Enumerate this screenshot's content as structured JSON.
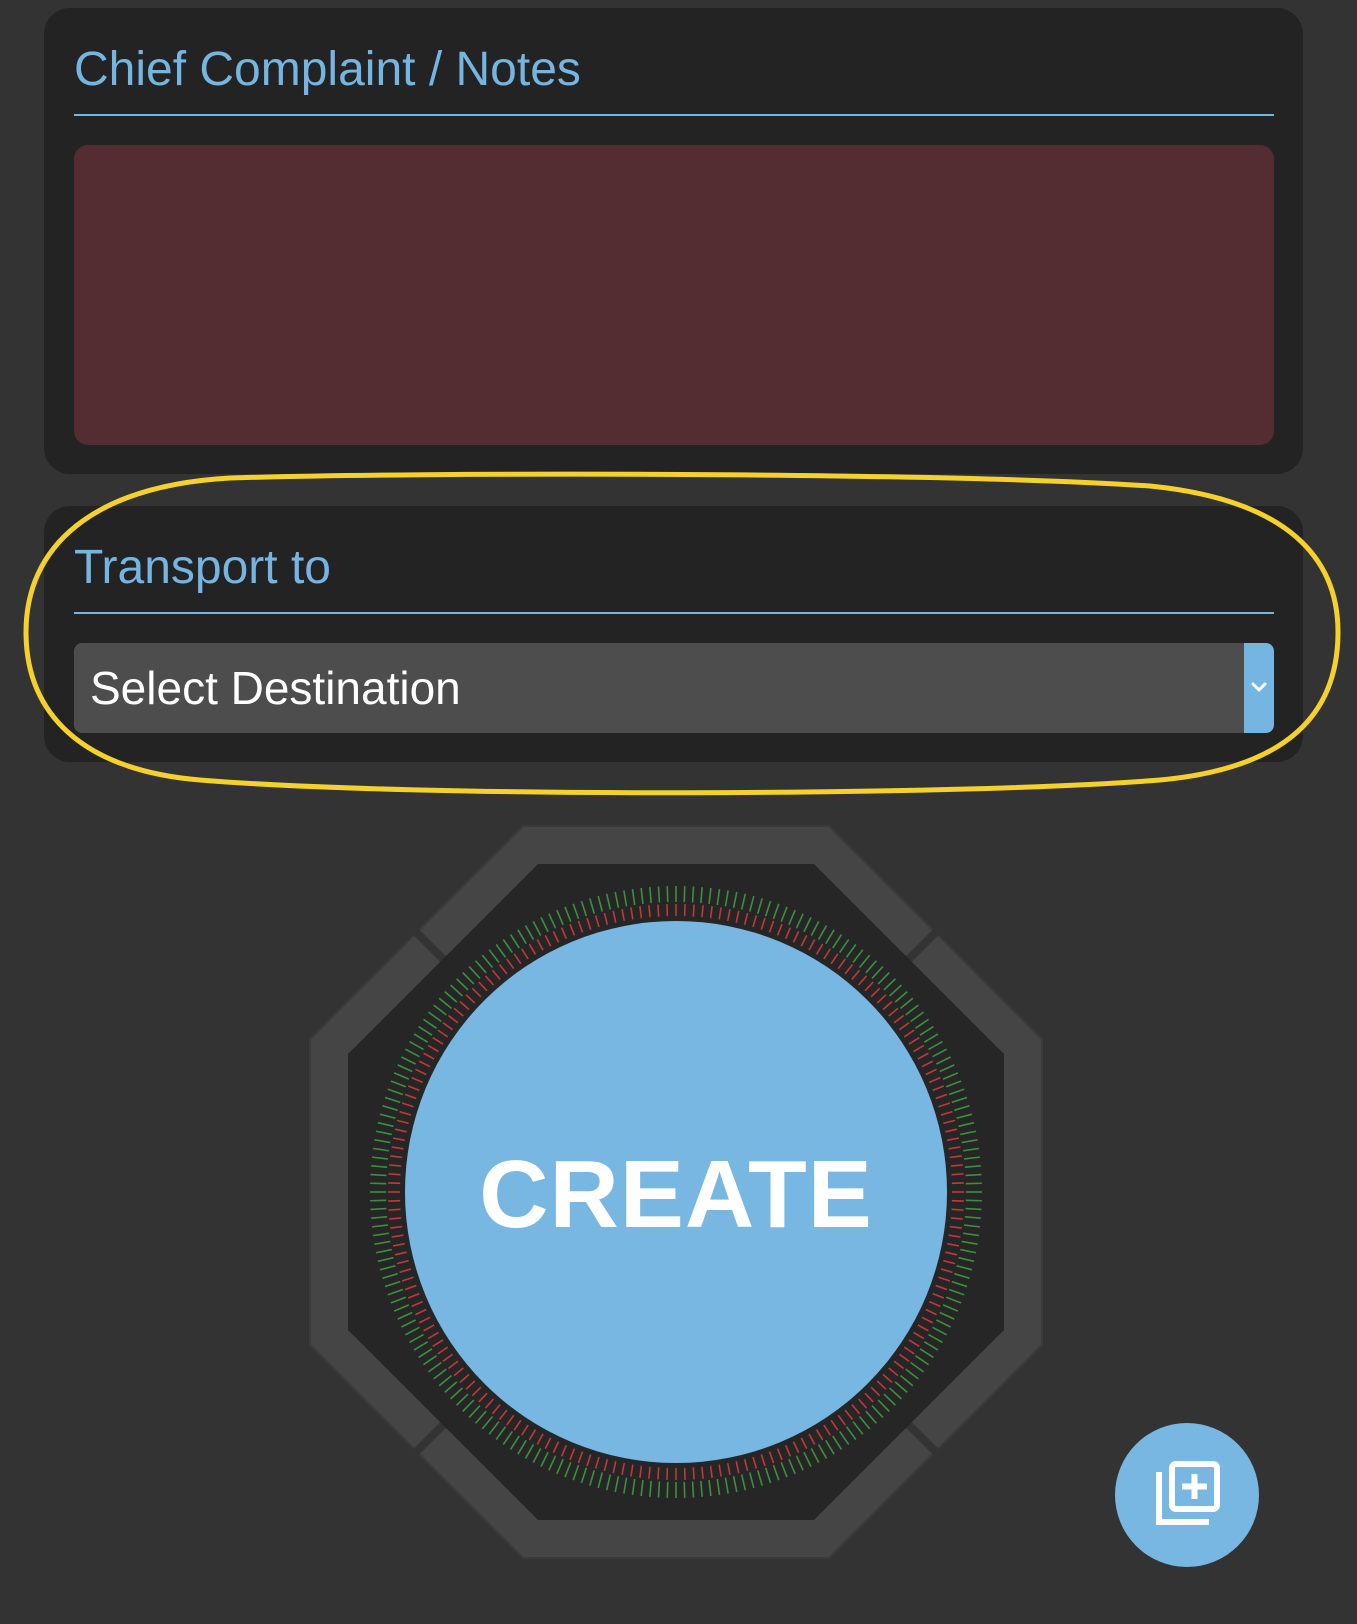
{
  "notes_card": {
    "title": "Chief Complaint / Notes",
    "textarea_value": "",
    "validation_state": "error",
    "warning_icon": "warning-triangle-icon"
  },
  "transport_card": {
    "title": "Transport to",
    "select_value": "Select Destination",
    "dropdown_icon": "chevron-down-icon",
    "highlighted": true
  },
  "create_button": {
    "label": "CREATE",
    "indicator_ring_colors": {
      "outer": "#3d8f3f",
      "inner": "#c0393b"
    }
  },
  "fab": {
    "icon": "add-to-library-icon"
  },
  "colors": {
    "background": "#333333",
    "card": "#232323",
    "accent": "#74b5e1",
    "error_field": "#532d32",
    "warning": "#e06b4d",
    "select_field": "#4d4d4d",
    "highlight": "#f4d22b"
  }
}
